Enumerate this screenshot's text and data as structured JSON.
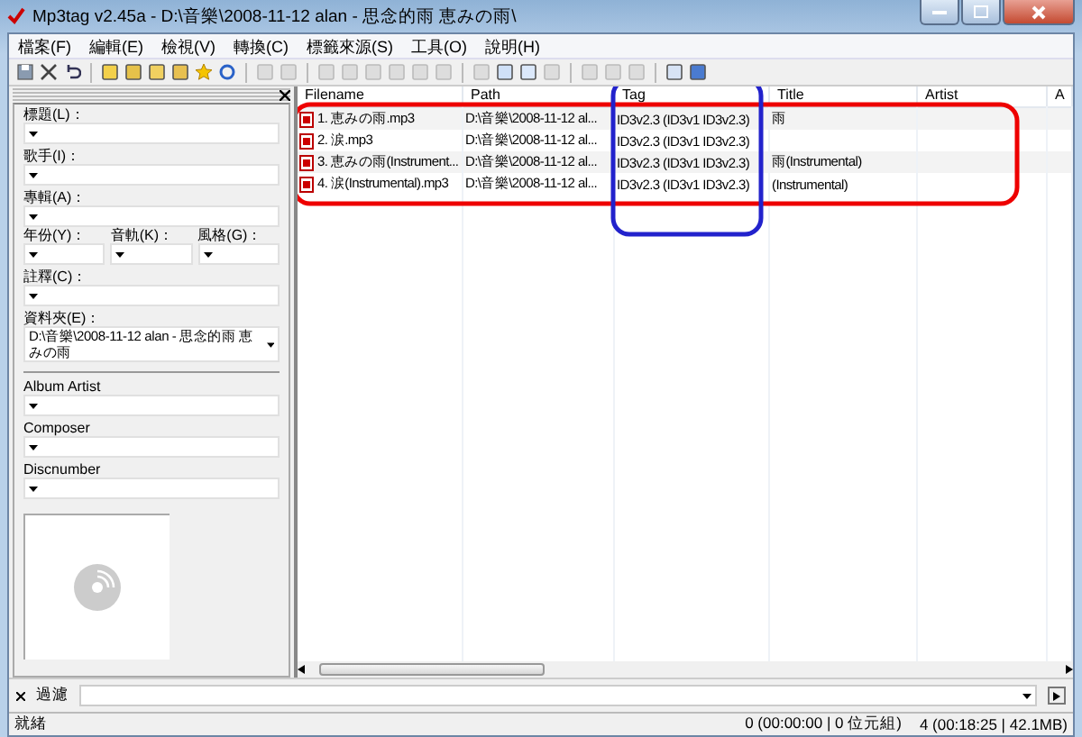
{
  "window": {
    "title": "Mp3tag v2.45a  -  D:\\音樂\\2008-11-12 alan - 思念的雨 恵みの雨\\"
  },
  "menu": [
    "檔案(F)",
    "編輯(E)",
    "檢視(V)",
    "轉換(C)",
    "標籤來源(S)",
    "工具(O)",
    "說明(H)"
  ],
  "tag_panel": {
    "fields": [
      {
        "label": "標題(L)：",
        "kind": "full"
      },
      {
        "label": "歌手(I)：",
        "kind": "full"
      },
      {
        "label": "專輯(A)：",
        "kind": "full"
      },
      {
        "label": "年份(Y)：",
        "kind": "third"
      },
      {
        "label": "音軌(K)：",
        "kind": "third"
      },
      {
        "label": "風格(G)：",
        "kind": "third"
      },
      {
        "label": "註釋(C)：",
        "kind": "full"
      },
      {
        "label": "資料夾(E)：",
        "kind": "full",
        "value": "D:\\音樂\\2008-11-12 alan - 思念的雨 恵みの雨"
      }
    ],
    "extended_fields": [
      {
        "label": "Album Artist"
      },
      {
        "label": "Composer"
      },
      {
        "label": "Discnumber"
      }
    ]
  },
  "file_list": {
    "columns": [
      "Filename",
      "Path",
      "Tag",
      "Title",
      "Artist",
      "A"
    ],
    "rows": [
      {
        "cells": [
          "1. 恵みの雨.mp3",
          "D:\\音樂\\2008-11-12 al...",
          "ID3v2.3 (ID3v1 ID3v2.3)",
          "雨",
          ""
        ]
      },
      {
        "cells": [
          "2. 涙.mp3",
          "D:\\音樂\\2008-11-12 al...",
          "ID3v2.3 (ID3v1 ID3v2.3)",
          "",
          ""
        ]
      },
      {
        "cells": [
          "3. 恵みの雨(Instrument...",
          "D:\\音樂\\2008-11-12 al...",
          "ID3v2.3 (ID3v1 ID3v2.3)",
          "雨(Instrumental)",
          ""
        ]
      },
      {
        "cells": [
          "4. 涙(Instrumental).mp3",
          "D:\\音樂\\2008-11-12 al...",
          "ID3v2.3 (ID3v1 ID3v2.3)",
          "(Instrumental)",
          ""
        ]
      }
    ]
  },
  "filter": {
    "label": "過濾"
  },
  "status_bar": {
    "state": "就緒",
    "selection": "0 (00:00:00 | 0 位元組)",
    "total": "4 (00:18:25 | 42.1MB)"
  }
}
